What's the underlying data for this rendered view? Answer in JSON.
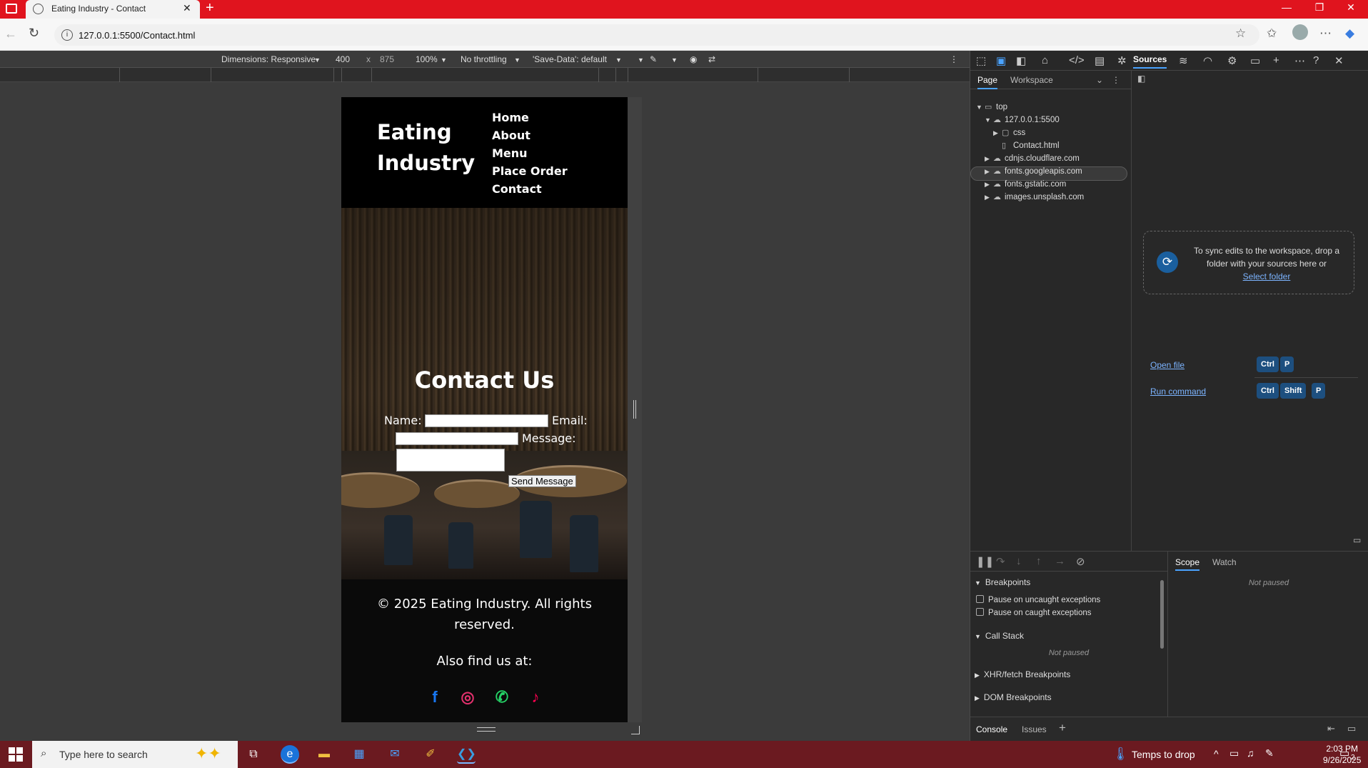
{
  "browser": {
    "tab_title": "Eating Industry - Contact",
    "url": "127.0.0.1:5500/Contact.html"
  },
  "device_toolbar": {
    "dimensions_label": "Dimensions: Responsive",
    "width": "400",
    "x": "x",
    "height": "875",
    "zoom": "100%",
    "throttling": "No throttling",
    "save_data": "'Save-Data': default"
  },
  "site": {
    "logo": "Eating Industry",
    "nav": [
      "Home",
      "About",
      "Menu",
      "Place Order",
      "Contact"
    ],
    "contact_title": "Contact Us",
    "form": {
      "name_label": "Name:",
      "email_label": "Email:",
      "message_label": "Message:",
      "send_button": "Send Message"
    },
    "footer": {
      "copyright": "© 2025 Eating Industry. All rights reserved.",
      "find_us": "Also find us at:"
    },
    "social": [
      {
        "name": "facebook-icon",
        "glyph": "f",
        "color": "#1877f2"
      },
      {
        "name": "instagram-icon",
        "glyph": "◎",
        "color": "#e1306c"
      },
      {
        "name": "whatsapp-icon",
        "glyph": "✆",
        "color": "#25d366"
      },
      {
        "name": "tiktok-icon",
        "glyph": "♪",
        "color": "#ff0050"
      }
    ]
  },
  "devtools": {
    "active_panel": "Sources",
    "page_tab": "Page",
    "workspace_tab": "Workspace",
    "tree": {
      "top": "top",
      "host": "127.0.0.1:5500",
      "css": "css",
      "file": "Contact.html",
      "domains": [
        "cdnjs.cloudflare.com",
        "fonts.googleapis.com",
        "fonts.gstatic.com",
        "images.unsplash.com"
      ]
    },
    "drop_text": "To sync edits to the workspace, drop a folder with your sources here or",
    "select_folder": "Select folder",
    "open_file": "Open file",
    "run_command": "Run command",
    "keys": {
      "ctrl": "Ctrl",
      "shift": "Shift",
      "p": "P"
    },
    "debugger": {
      "breakpoints": "Breakpoints",
      "pause_uncaught": "Pause on uncaught exceptions",
      "pause_caught": "Pause on caught exceptions",
      "call_stack": "Call Stack",
      "not_paused": "Not paused",
      "xhr": "XHR/fetch Breakpoints",
      "dom": "DOM Breakpoints",
      "scope": "Scope",
      "watch": "Watch",
      "scope_not_paused": "Not paused"
    },
    "drawer": {
      "console": "Console",
      "issues": "Issues"
    }
  },
  "taskbar": {
    "search_placeholder": "Type here to search",
    "weather": "Temps to drop",
    "time": "2:03 PM",
    "date": "9/26/2025",
    "notifications": "2"
  }
}
